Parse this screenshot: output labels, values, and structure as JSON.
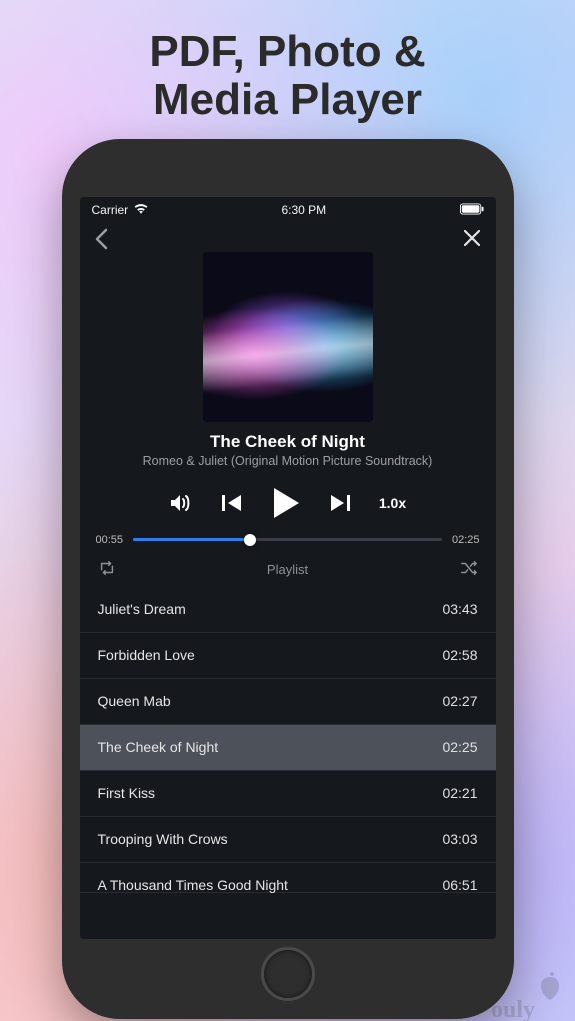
{
  "promo": {
    "title_line1": "PDF, Photo &",
    "title_line2": "Media Player"
  },
  "status_bar": {
    "carrier": "Carrier",
    "time": "6:30 PM"
  },
  "now_playing": {
    "title": "The Cheek of Night",
    "artist": "Romeo & Juliet (Original Motion Picture Soundtrack)",
    "speed_label": "1.0x",
    "elapsed": "00:55",
    "duration": "02:25",
    "progress_percent": 38
  },
  "playlist": {
    "header_label": "Playlist",
    "tracks": [
      {
        "title": "Juliet's Dream",
        "duration": "03:43",
        "active": false
      },
      {
        "title": "Forbidden Love",
        "duration": "02:58",
        "active": false
      },
      {
        "title": "Queen Mab",
        "duration": "02:27",
        "active": false
      },
      {
        "title": "The Cheek of Night",
        "duration": "02:25",
        "active": true
      },
      {
        "title": "First Kiss",
        "duration": "02:21",
        "active": false
      },
      {
        "title": "Trooping With Crows",
        "duration": "03:03",
        "active": false
      }
    ],
    "partial_next": {
      "title": "A Thousand Times Good Night",
      "duration": "06:51"
    }
  }
}
